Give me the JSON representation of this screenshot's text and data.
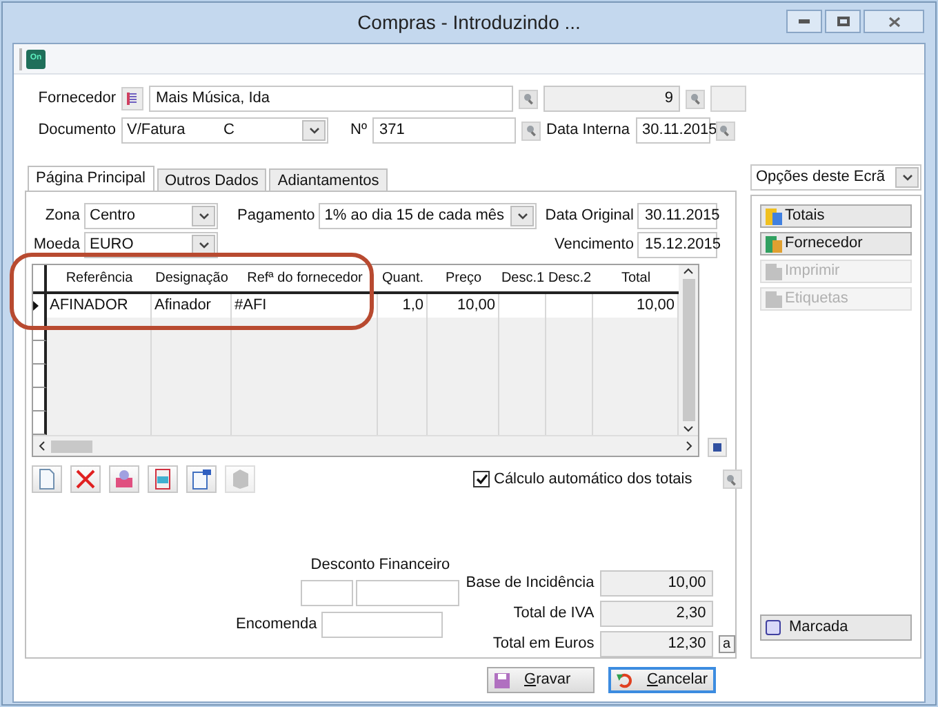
{
  "window": {
    "title": "Compras - Introduzindo ..."
  },
  "app_logo": "On",
  "supplier": {
    "label": "Fornecedor",
    "value": "Mais Música, Ida",
    "code": "9"
  },
  "document": {
    "label": "Documento",
    "type": "V/Fatura",
    "series": "C",
    "number_label": "Nº",
    "number": "371",
    "date_label": "Data Interna",
    "date": "30.11.2015"
  },
  "tabs": [
    {
      "label": "Página Principal",
      "selected": true
    },
    {
      "label": "Outros Dados",
      "selected": false
    },
    {
      "label": "Adiantamentos",
      "selected": false
    }
  ],
  "main": {
    "zone": {
      "label": "Zona",
      "value": "Centro"
    },
    "currency": {
      "label": "Moeda",
      "value": "EURO"
    },
    "payment": {
      "label": "Pagamento",
      "value": "1% ao dia 15 de cada mês"
    },
    "original_date": {
      "label": "Data Original",
      "value": "30.11.2015"
    },
    "due_date": {
      "label": "Vencimento",
      "value": "15.12.2015"
    }
  },
  "table": {
    "columns": [
      {
        "label": "Referência"
      },
      {
        "label": "Designação"
      },
      {
        "label": "Refª do fornecedor"
      },
      {
        "label": "Quant."
      },
      {
        "label": "Preço"
      },
      {
        "label": "Desc.1"
      },
      {
        "label": "Desc.2"
      },
      {
        "label": "Total"
      }
    ],
    "rows": [
      {
        "current": true,
        "cells": [
          "AFINADOR",
          "Afinador",
          "#AFI",
          "1,0",
          "10,00",
          "",
          "",
          "10,00"
        ]
      }
    ]
  },
  "auto_totals": {
    "label": "Cálculo automático dos totais",
    "checked": true
  },
  "financial_discount": {
    "label": "Desconto Financeiro"
  },
  "order": {
    "label": "Encomenda"
  },
  "totals": [
    {
      "label": "Base de Incidência",
      "value": "10,00"
    },
    {
      "label": "Total de IVA",
      "value": "2,30"
    },
    {
      "label": "Total em Euros",
      "value": "12,30"
    }
  ],
  "totals_button": "a",
  "side": {
    "title": "Opções deste Ecrã",
    "actions": [
      {
        "label": "Totais",
        "disabled": false
      },
      {
        "label": "Fornecedor",
        "disabled": false
      },
      {
        "label": "Imprimir",
        "disabled": true
      },
      {
        "label": "Etiquetas",
        "disabled": true
      }
    ],
    "marked": {
      "label": "Marcada"
    }
  },
  "buttons": [
    {
      "label": "Gravar",
      "focused": false
    },
    {
      "label": "Cancelar",
      "focused": true
    }
  ]
}
